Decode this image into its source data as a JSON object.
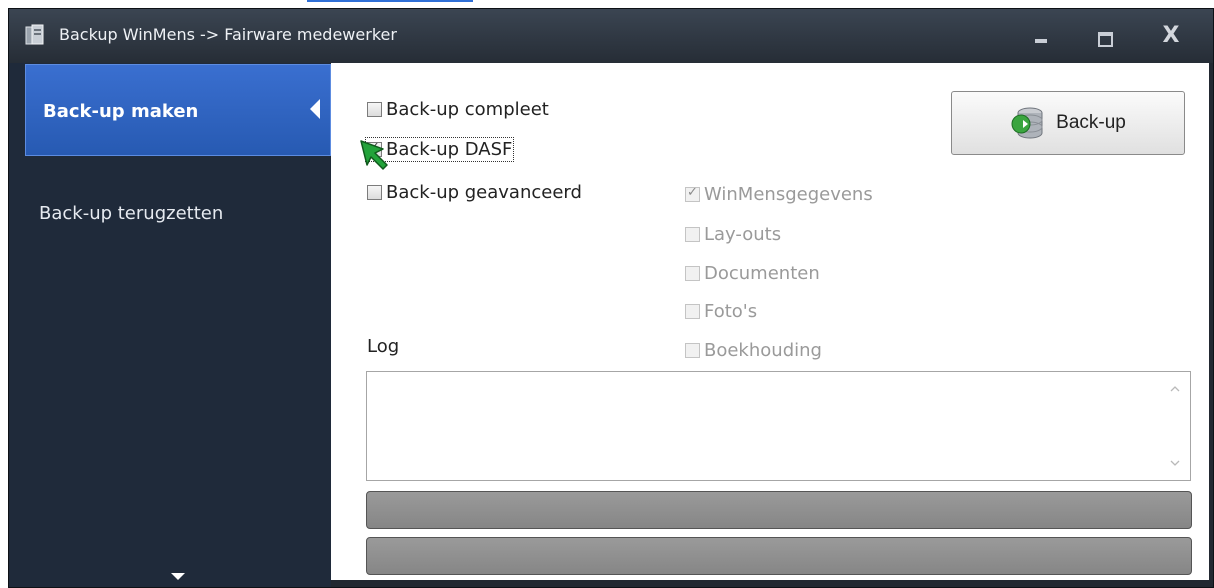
{
  "window": {
    "title": "Backup WinMens -> Fairware medewerker",
    "controls": {
      "minimize_icon": "minimize-icon",
      "maximize_icon": "maximize-icon",
      "close_label": "X"
    }
  },
  "sidebar": {
    "items": [
      {
        "label": "Back-up maken",
        "active": true
      },
      {
        "label": "Back-up terugzetten",
        "active": false
      }
    ],
    "scroll_icon": "chevron-down-icon"
  },
  "options": {
    "compleet": {
      "label": "Back-up compleet",
      "checked": false
    },
    "dasf": {
      "label": "Back-up DASF",
      "checked": true
    },
    "geavanceerd": {
      "label": "Back-up geavanceerd",
      "checked": false
    }
  },
  "advanced": {
    "items": [
      {
        "label": "WinMensgegevens",
        "checked": true,
        "enabled": false
      },
      {
        "label": "Lay-outs",
        "checked": false,
        "enabled": false
      },
      {
        "label": "Documenten",
        "checked": false,
        "enabled": false
      },
      {
        "label": "Foto's",
        "checked": false,
        "enabled": false
      },
      {
        "label": "Boekhouding",
        "checked": false,
        "enabled": false
      }
    ]
  },
  "actions": {
    "backup_label": "Back-up",
    "backup_icon": "database-backup-icon"
  },
  "log": {
    "label": "Log",
    "content": ""
  },
  "progress": {
    "bar1": 0,
    "bar2": 0
  },
  "colors": {
    "accent": "#2f63c0",
    "sidebar": "#1f2a3a",
    "titlebar": "#2f3640",
    "cursor": "#22a33a"
  }
}
